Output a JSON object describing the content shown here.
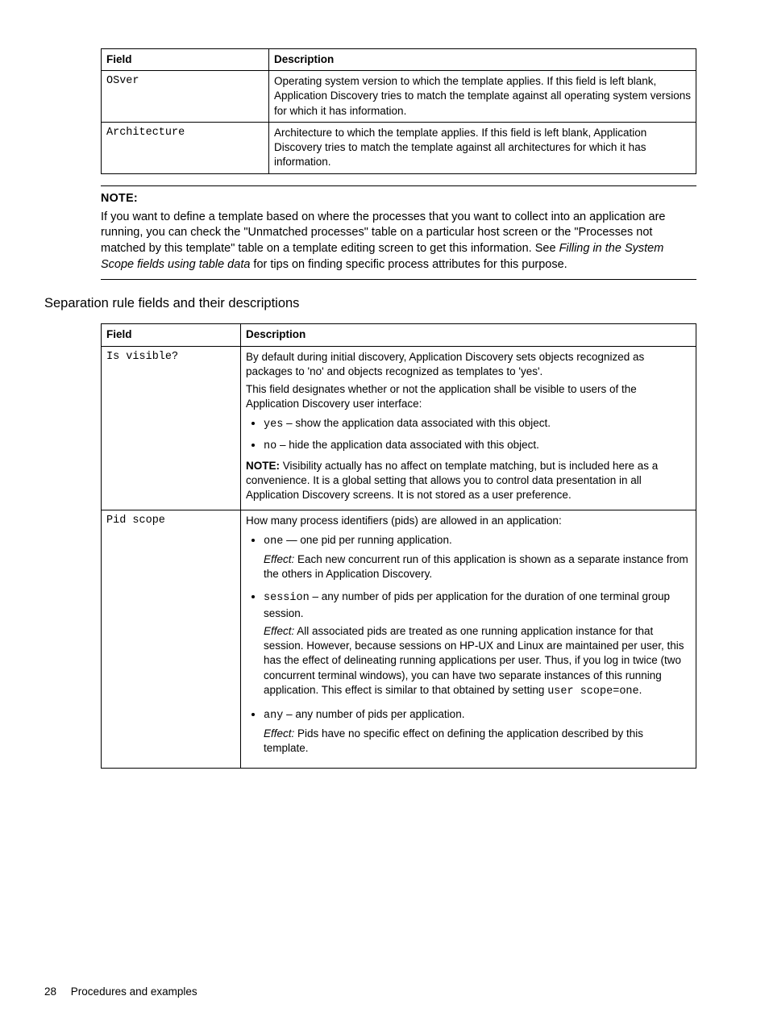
{
  "table1": {
    "headers": {
      "field": "Field",
      "description": "Description"
    },
    "rows": [
      {
        "field": "OSver",
        "desc": "Operating system version to which the template applies. If this field is left blank, Application Discovery tries to match the template against all operating system versions for which it has information."
      },
      {
        "field": "Architecture",
        "desc": "Architecture to which the template applies. If this field is left blank, Application Discovery tries to match the template against all architectures for which it has information."
      }
    ]
  },
  "note": {
    "label": "NOTE:",
    "body_pre": "If you want to define a template based on where the processes that you want to collect into an application are running, you can check the \"Unmatched processes\" table on a particular host screen or the \"Processes not matched by this template\" table on a template editing screen to get this information.  See ",
    "body_italic": "Filling in the System Scope fields using table data",
    "body_post": " for tips on finding specific process attributes for this purpose."
  },
  "section_heading": "Separation rule fields and their descriptions",
  "table2": {
    "headers": {
      "field": "Field",
      "description": "Description"
    },
    "row_visible": {
      "field": "Is visible?",
      "p1": "By default during initial discovery, Application Discovery sets objects recognized as packages to 'no' and objects recognized as templates to 'yes'.",
      "p2": "This field designates whether or not the application shall be visible to users of the Application Discovery user interface:",
      "li_yes_code": "yes",
      "li_yes_text": " – show the application data associated with this object.",
      "li_no_code": "no",
      "li_no_text": " – hide the application data associated with this object.",
      "note_label": "NOTE:",
      "note_text": "   Visibility actually has no affect on template matching, but is included here as a convenience. It is a global setting that allows you to control data presentation in all Application Discovery screens. It is not stored as a user preference."
    },
    "row_pid": {
      "field": "Pid scope",
      "intro": "How many process identifiers (pids) are allowed in an application:",
      "li_one_code": "one",
      "li_one_text": " — one pid per running application.",
      "effect_label": "Effect:",
      "effect_one": " Each new concurrent run of this application is shown as a separate instance from the others in Application Discovery.",
      "li_session_code": "session",
      "li_session_text": " – any number of pids per application for the duration of one terminal group session.",
      "effect_session_pre": " All associated pids are treated as one running application instance for that session. However, because sessions on HP-UX and Linux are maintained per user, this has the effect of delineating running applications per user. Thus, if you log in twice (two concurrent terminal windows), you can have two separate instances of this running application. This effect is similar to that obtained by setting ",
      "effect_session_code": "user scope=one",
      "effect_session_post": ".",
      "li_any_code": "any",
      "li_any_text": " – any number of pids per application.",
      "effect_any": " Pids have no specific effect on defining the application described by this template."
    }
  },
  "footer": {
    "page_number": "28",
    "section": "Procedures and examples"
  }
}
